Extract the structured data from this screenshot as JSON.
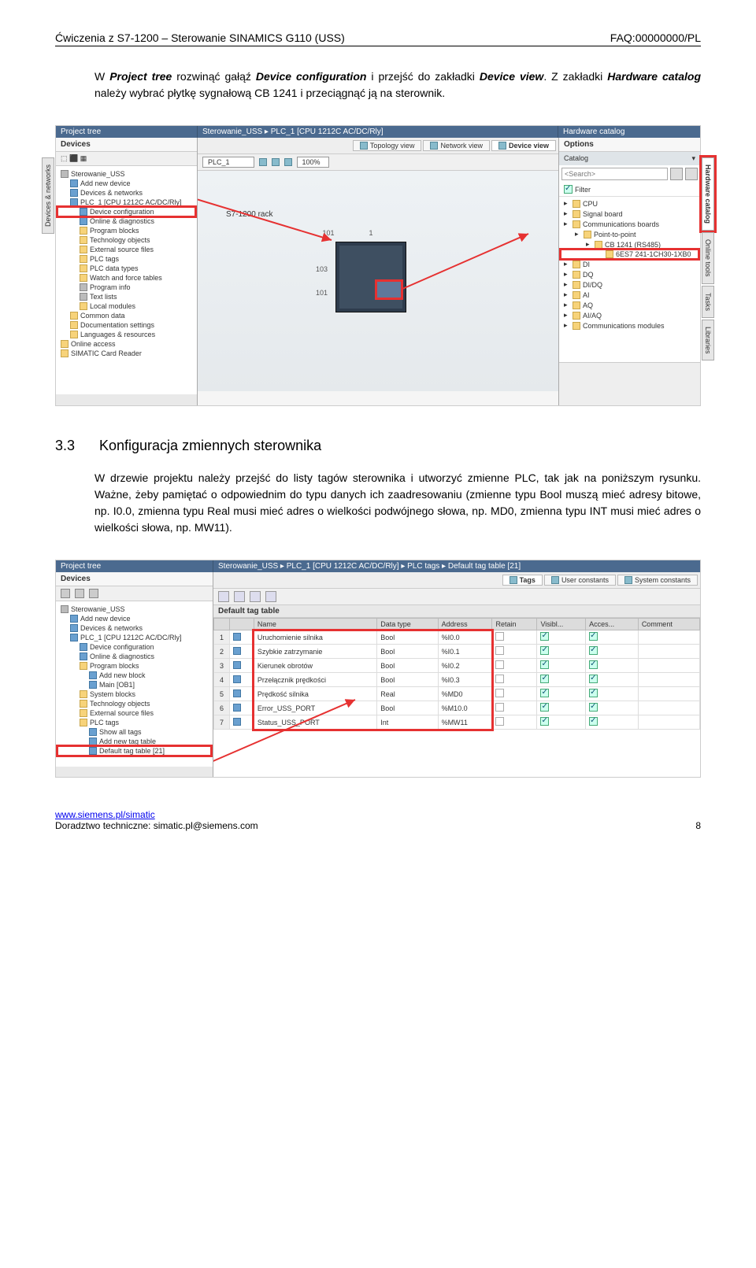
{
  "header": {
    "left": "Ćwiczenia z S7-1200 – Sterowanie SINAMICS G110 (USS)",
    "right": "FAQ:00000000/PL"
  },
  "intro": {
    "p1a": "W ",
    "p1b": "Project tree",
    "p1c": " rozwinąć gałąź ",
    "p1d": "Device configuration",
    "p1e": " i przejść do zakładki ",
    "p1f": "Device view",
    "p1g": ". Z zakładki ",
    "p1h": "Hardware catalog",
    "p1i": " należy wybrać płytkę sygnałową CB 1241 i przeciągnąć ją na sterownik."
  },
  "ss1": {
    "title_left": "Project tree",
    "title_center": "Sterowanie_USS  ▸  PLC_1 [CPU 1212C AC/DC/Rly]",
    "title_right": "Hardware catalog",
    "left_hdr": "Devices",
    "tree": [
      {
        "depth": 1,
        "icon": "grey",
        "label": "Sterowanie_USS"
      },
      {
        "depth": 2,
        "icon": "blue",
        "label": "Add new device"
      },
      {
        "depth": 2,
        "icon": "blue",
        "label": "Devices & networks"
      },
      {
        "depth": 2,
        "icon": "blue",
        "label": "PLC_1 [CPU 1212C AC/DC/Rly]"
      },
      {
        "depth": 3,
        "icon": "blue",
        "label": "Device configuration",
        "hl": true
      },
      {
        "depth": 3,
        "icon": "blue",
        "label": "Online & diagnostics"
      },
      {
        "depth": 3,
        "icon": "folder",
        "label": "Program blocks"
      },
      {
        "depth": 3,
        "icon": "folder",
        "label": "Technology objects"
      },
      {
        "depth": 3,
        "icon": "folder",
        "label": "External source files"
      },
      {
        "depth": 3,
        "icon": "folder",
        "label": "PLC tags"
      },
      {
        "depth": 3,
        "icon": "folder",
        "label": "PLC data types"
      },
      {
        "depth": 3,
        "icon": "folder",
        "label": "Watch and force tables"
      },
      {
        "depth": 3,
        "icon": "grey",
        "label": "Program info"
      },
      {
        "depth": 3,
        "icon": "grey",
        "label": "Text lists"
      },
      {
        "depth": 3,
        "icon": "folder",
        "label": "Local modules"
      },
      {
        "depth": 2,
        "icon": "folder",
        "label": "Common data"
      },
      {
        "depth": 2,
        "icon": "folder",
        "label": "Documentation settings"
      },
      {
        "depth": 2,
        "icon": "folder",
        "label": "Languages & resources"
      },
      {
        "depth": 1,
        "icon": "folder",
        "label": "Online access"
      },
      {
        "depth": 1,
        "icon": "folder",
        "label": "SIMATIC Card Reader"
      }
    ],
    "viewtabs": {
      "topology": "Topology view",
      "network": "Network view",
      "device": "Device view"
    },
    "plcdrop": "PLC_1",
    "zoom": "100%",
    "rack_label": "S7-1200 rack",
    "slot101": "101",
    "slot1": "1",
    "slot103": "103",
    "slot101b": "101",
    "right_hdr": "Options",
    "cat_hdr": "Catalog",
    "search_ph": "<Search>",
    "filter": "Filter",
    "catalog": [
      {
        "depth": 1,
        "label": "CPU"
      },
      {
        "depth": 1,
        "label": "Signal board"
      },
      {
        "depth": 1,
        "label": "Communications boards"
      },
      {
        "depth": 2,
        "label": "Point-to-point"
      },
      {
        "depth": 3,
        "label": "CB 1241 (RS485)"
      },
      {
        "depth": 4,
        "label": "6ES7 241-1CH30-1XB0",
        "hl": true
      },
      {
        "depth": 1,
        "label": "DI"
      },
      {
        "depth": 1,
        "label": "DQ"
      },
      {
        "depth": 1,
        "label": "DI/DQ"
      },
      {
        "depth": 1,
        "label": "AI"
      },
      {
        "depth": 1,
        "label": "AQ"
      },
      {
        "depth": 1,
        "label": "AI/AQ"
      },
      {
        "depth": 1,
        "label": "Communications modules"
      }
    ],
    "vtab_hw": "Hardware catalog",
    "vtab_online": "Online tools",
    "vtab_tasks": "Tasks",
    "vtab_lib": "Libraries",
    "vtab_dev": "Devices & networks"
  },
  "section": {
    "num": "3.3",
    "title": "Konfiguracja zmiennych sterownika"
  },
  "body2": "W drzewie projektu należy przejść do listy tagów sterownika i utworzyć zmienne PLC, tak jak na poniższym rysunku. Ważne, żeby pamiętać o odpowiednim do typu danych ich zaadresowaniu (zmienne typu Bool muszą mieć adresy bitowe, np. I0.0, zmienna typu Real musi mieć adres o wielkości podwójnego słowa, np. MD0, zmienna typu INT musi mieć adres o wielkości słowa, np. MW11).",
  "ss2": {
    "title_left": "Project tree",
    "title_right": "Sterowanie_USS  ▸  PLC_1 [CPU 1212C AC/DC/Rly]  ▸  PLC tags  ▸  Default tag table [21]",
    "left_hdr": "Devices",
    "tree": [
      {
        "depth": 1,
        "icon": "grey",
        "label": "Sterowanie_USS"
      },
      {
        "depth": 2,
        "icon": "blue",
        "label": "Add new device"
      },
      {
        "depth": 2,
        "icon": "blue",
        "label": "Devices & networks"
      },
      {
        "depth": 2,
        "icon": "blue",
        "label": "PLC_1 [CPU 1212C AC/DC/Rly]"
      },
      {
        "depth": 3,
        "icon": "blue",
        "label": "Device configuration"
      },
      {
        "depth": 3,
        "icon": "blue",
        "label": "Online & diagnostics"
      },
      {
        "depth": 3,
        "icon": "folder",
        "label": "Program blocks"
      },
      {
        "depth": 4,
        "icon": "blue",
        "label": "Add new block"
      },
      {
        "depth": 4,
        "icon": "blue",
        "label": "Main [OB1]"
      },
      {
        "depth": 3,
        "icon": "folder",
        "label": "System blocks"
      },
      {
        "depth": 3,
        "icon": "folder",
        "label": "Technology objects"
      },
      {
        "depth": 3,
        "icon": "folder",
        "label": "External source files"
      },
      {
        "depth": 3,
        "icon": "folder",
        "label": "PLC tags"
      },
      {
        "depth": 4,
        "icon": "blue",
        "label": "Show all tags"
      },
      {
        "depth": 4,
        "icon": "blue",
        "label": "Add new tag table"
      },
      {
        "depth": 4,
        "icon": "blue",
        "label": "Default tag table [21]",
        "hl": true
      }
    ],
    "tabs": {
      "tags": "Tags",
      "uc": "User constants",
      "sc": "System constants"
    },
    "tablehdr": "Default tag table",
    "cols": {
      "name": "Name",
      "dtype": "Data type",
      "addr": "Address",
      "retain": "Retain",
      "visibl": "Visibl...",
      "acces": "Acces...",
      "comment": "Comment"
    },
    "rows": [
      {
        "n": "1",
        "name": "Uruchomienie silnika",
        "dtype": "Bool",
        "addr": "%I0.0",
        "retain": false,
        "vis": true,
        "acc": true
      },
      {
        "n": "2",
        "name": "Szybkie zatrzymanie",
        "dtype": "Bool",
        "addr": "%I0.1",
        "retain": false,
        "vis": true,
        "acc": true
      },
      {
        "n": "3",
        "name": "Kierunek obrotów",
        "dtype": "Bool",
        "addr": "%I0.2",
        "retain": false,
        "vis": true,
        "acc": true
      },
      {
        "n": "4",
        "name": "Przełącznik prędkości",
        "dtype": "Bool",
        "addr": "%I0.3",
        "retain": false,
        "vis": true,
        "acc": true
      },
      {
        "n": "5",
        "name": "Prędkość silnika",
        "dtype": "Real",
        "addr": "%MD0",
        "retain": false,
        "vis": true,
        "acc": true
      },
      {
        "n": "6",
        "name": "Error_USS_PORT",
        "dtype": "Bool",
        "addr": "%M10.0",
        "retain": false,
        "vis": true,
        "acc": true
      },
      {
        "n": "7",
        "name": "Status_USS_PORT",
        "dtype": "Int",
        "addr": "%MW11",
        "retain": false,
        "vis": true,
        "acc": true
      }
    ]
  },
  "footer": {
    "url": "www.siemens.pl/simatic",
    "line2": "Doradztwo techniczne: simatic.pl@siemens.com",
    "page": "8"
  }
}
